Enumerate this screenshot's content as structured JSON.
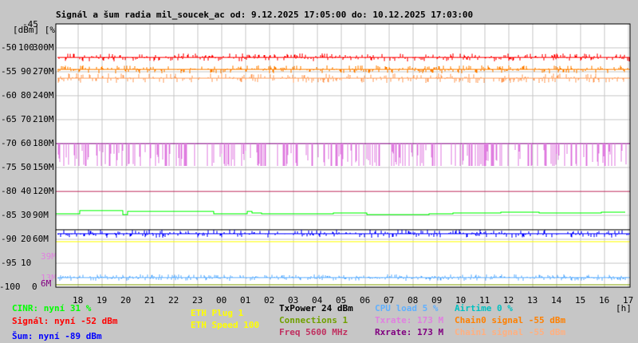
{
  "chart_data": {
    "type": "line",
    "title": "Signál a šum radia mil_soucek_ac od: 9.12.2025 17:05:00 do: 10.12.2025 17:03:00",
    "ylabel": "[dBm] [%]",
    "xlabel": "[h]",
    "ylim": [
      -100,
      -45
    ],
    "grid": true,
    "y_ticks_dbm": [
      "-45",
      "-50",
      "-55",
      "-60",
      "-65",
      "-70",
      "-75",
      "-80",
      "-85",
      "-90",
      "-95",
      "-100"
    ],
    "y_ticks_pct": [
      "100",
      "90",
      "80",
      "70",
      "60",
      "50",
      "40",
      "30",
      "20",
      "10",
      "0"
    ],
    "y_ticks_rate": [
      "300M",
      "270M",
      "240M",
      "210M",
      "180M",
      "150M",
      "120M",
      "90M",
      "60M"
    ],
    "extra_rate_labels": [
      {
        "text": "39M",
        "color": "#e080e0"
      },
      {
        "text": "13M",
        "color": "#e080e0"
      },
      {
        "text": "6M",
        "color": "#800080"
      }
    ],
    "x_ticks": [
      "18",
      "19",
      "20",
      "21",
      "22",
      "23",
      "00",
      "01",
      "02",
      "03",
      "04",
      "05",
      "06",
      "07",
      "08",
      "09",
      "10",
      "11",
      "12",
      "13",
      "14",
      "15",
      "16",
      "17"
    ],
    "series": [
      {
        "name": "Signál",
        "color": "#ff0000",
        "level_dbm": -52,
        "spread": 2
      },
      {
        "name": "Chain0 signal",
        "color": "#ff8000",
        "level_dbm": -54.5,
        "spread": 1.5
      },
      {
        "name": "Chain1 signal",
        "color": "#ffa060",
        "level_dbm": -56,
        "spread": 2
      },
      {
        "name": "Txrate",
        "color": "#e080e0",
        "level_rate_m": 173,
        "dips_to_rate_m": 150
      },
      {
        "name": "Rxrate",
        "color": "#800080",
        "level_rate_m": 180
      },
      {
        "name": "Freq",
        "color": "#c03060",
        "level_dbm": -80
      },
      {
        "name": "CINR",
        "color": "#00ff00",
        "level_pct": 31
      },
      {
        "name": "Šum",
        "color": "#0000ff",
        "level_dbm": -89
      },
      {
        "name": "ETH Speed",
        "color": "#ffff00",
        "level_dbm": -90.5
      },
      {
        "name": "CPU load",
        "color": "#60b0ff",
        "level_pct": 5
      },
      {
        "name": "Connections",
        "color": "#80a000",
        "level_pct": 1
      }
    ]
  },
  "legend": {
    "cinr": "CINR: nyní 31 %",
    "signal": "Signál: nyní -52 dBm",
    "sum": "Šum: nyní -89 dBm",
    "eth_plug": "ETH Plug 1",
    "eth_speed": "ETH Speed 100",
    "txpower": "TxPower 24 dBm",
    "connections": "Connections 1",
    "freq": "Freq 5600 MHz",
    "cpu": "CPU load 5 %",
    "txrate": "Txrate: 173 M",
    "rxrate": "Rxrate: 173 M",
    "airtime": "Airtime 0 %",
    "chain0": "Chain0 signal -55 dBm",
    "chain1": "Chain1 signal -55 dBm"
  }
}
